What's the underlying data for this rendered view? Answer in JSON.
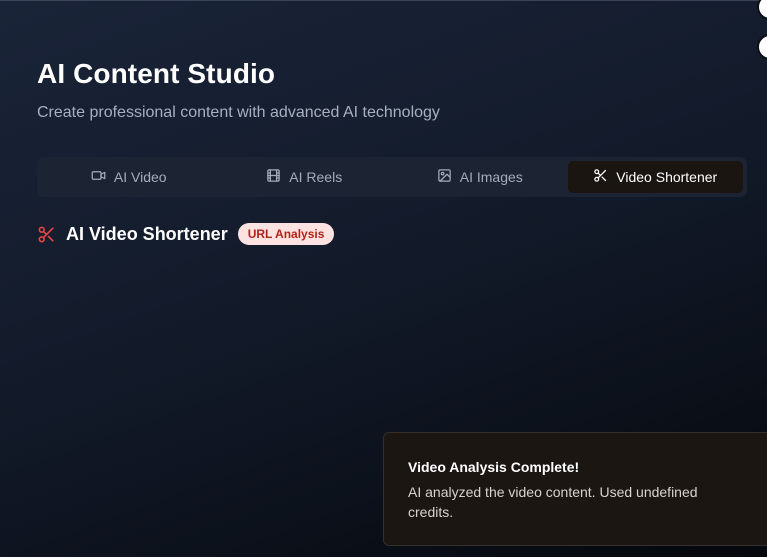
{
  "header": {
    "title": "AI Content Studio",
    "subtitle": "Create professional content with advanced AI technology"
  },
  "tabs": [
    {
      "label": "AI Video",
      "icon": "video-icon",
      "active": false
    },
    {
      "label": "AI Reels",
      "icon": "film-icon",
      "active": false
    },
    {
      "label": "AI Images",
      "icon": "image-icon",
      "active": false
    },
    {
      "label": "Video Shortener",
      "icon": "scissors-icon",
      "active": true
    }
  ],
  "section": {
    "icon": "scissors-icon",
    "title": "AI Video Shortener",
    "badge": "URL Analysis"
  },
  "toast": {
    "title": "Video Analysis Complete!",
    "message": "AI analyzed the video content. Used undefined credits."
  },
  "colors": {
    "accent_red": "#ef4444",
    "badge_bg": "#fde2e2",
    "badge_text": "#b42318",
    "active_tab_bg": "#1b1512"
  }
}
